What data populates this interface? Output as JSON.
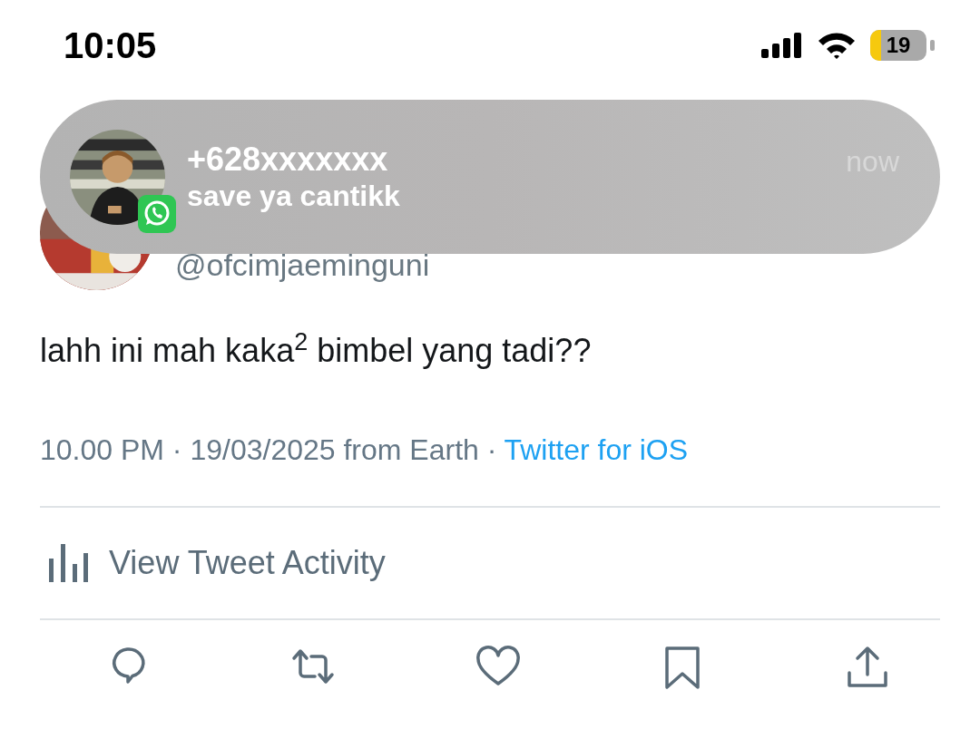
{
  "status_bar": {
    "time": "10:05",
    "battery": "19"
  },
  "notification": {
    "sender": "+628xxxxxxx",
    "message": "save ya cantikk",
    "time": "now"
  },
  "tweet": {
    "handle": "@ofcimjaeminguni",
    "text": "lahh ini mah kaka$^{2}$ bimbel yang tadi??",
    "timestamp": "10.00 PM · 19/03/2025 from Earth ·",
    "source": "Twitter for iOS",
    "activity": "View Tweet Activity",
    "actions": [
      {
        "kind": "reply"
      },
      {
        "kind": "retweet"
      },
      {
        "kind": "like"
      },
      {
        "kind": "bookmark"
      },
      {
        "kind": "share"
      }
    ]
  }
}
